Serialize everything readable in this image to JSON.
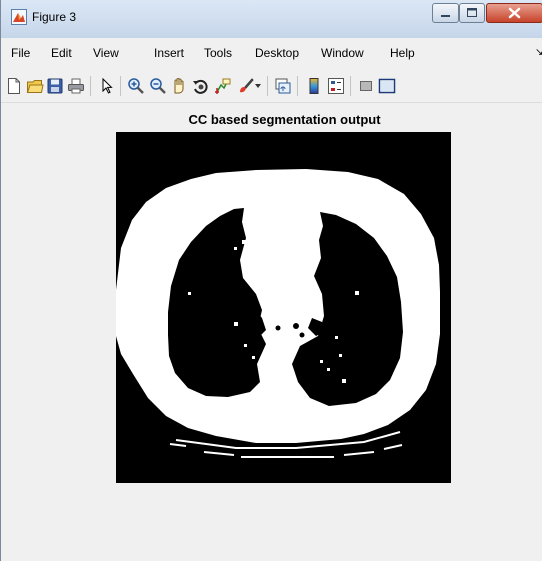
{
  "window": {
    "title": "Figure 3"
  },
  "menu": [
    "File",
    "Edit",
    "View",
    "Insert",
    "Tools",
    "Desktop",
    "Window",
    "Help"
  ],
  "toolbar": [
    "new-figure-icon",
    "open-file-icon",
    "save-icon",
    "print-icon",
    "pointer-icon",
    "zoom-in-icon",
    "zoom-out-icon",
    "pan-icon",
    "rotate-3d-icon",
    "data-cursor-icon",
    "brush-icon",
    "link-plot-icon",
    "colorbar-icon",
    "legend-icon",
    "hide-plot-tools-icon",
    "show-plot-tools-icon"
  ],
  "plot": {
    "title": "CC based segmentation output"
  },
  "colors": {
    "background": "#000000",
    "foreground": "#ffffff",
    "titlebar": "#dbe7f5",
    "close_button": "#c7432b"
  }
}
